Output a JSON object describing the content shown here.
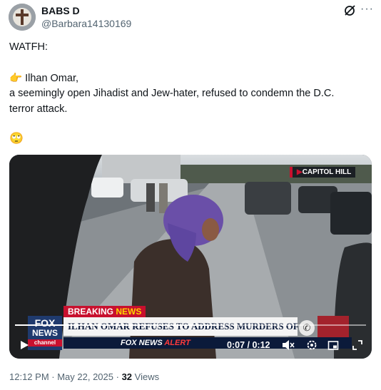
{
  "author": {
    "display_name": "BABS D",
    "handle": "@Barbara14130169"
  },
  "tweet": {
    "line1": "WATFH:",
    "line2_emoji": "👉",
    "line2": "Ilhan Omar,",
    "line3": "a seemingly open Jihadist and Jew-hater, refused to condemn the D.C.",
    "line4": "terror attack.",
    "line5_emoji": "🙄"
  },
  "video": {
    "location_tag": "CAPITOL HILL",
    "breaking_label_a": "BREAKING ",
    "breaking_label_b": "NEWS",
    "headline": "ILHAN OMAR REFUSES TO ADDRESS MURDERS OF ISRAELIS",
    "logo_top": "FOX",
    "logo_mid": "NEWS",
    "logo_bottom": "channel",
    "ticker_a": "FOX NEWS ",
    "ticker_b": "ALERT",
    "time_current": "0:07",
    "time_separator": " / ",
    "time_total": "0:12",
    "progress_fraction": 0.58
  },
  "meta": {
    "time": "12:12 PM",
    "separator": " · ",
    "date": "May 22, 2025",
    "views_count": "32",
    "views_label": " Views"
  },
  "colors": {
    "text": "#0f1419",
    "muted": "#536471",
    "breaking_red": "#c8102e",
    "fox_blue": "#1f3a6e"
  },
  "icons": [
    "cross-avatar-icon",
    "grok-icon",
    "more-icon",
    "pointing-right-emoji",
    "eye-roll-emoji",
    "play-icon",
    "volume-mute-icon",
    "settings-icon",
    "pip-icon",
    "fullscreen-icon",
    "phone-icon"
  ]
}
